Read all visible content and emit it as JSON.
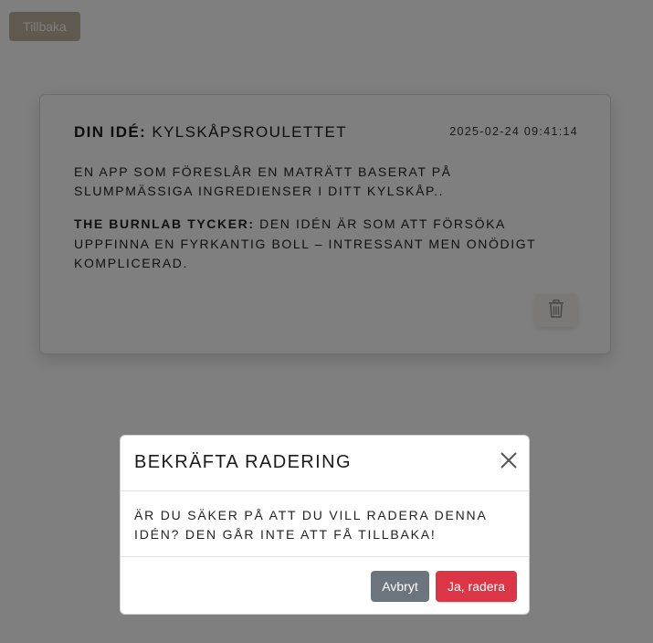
{
  "header": {
    "back_label": "Tillbaka"
  },
  "idea": {
    "title_prefix": "Din idé:",
    "title": "Kylskåpsroulettet",
    "timestamp": "2025-02-24 09:41:14",
    "description": "En app som föreslår en maträtt baserat på slumpmässiga ingredienser i ditt kylskåp..",
    "review_label": "The BurnLab tycker:",
    "review_text": "Den idén är som att försöka uppfinna en fyrkantig boll – intressant men onödigt komplicerad."
  },
  "modal": {
    "title": "Bekräfta radering",
    "body": "Är du säker på att du vill radera denna idén? Den går inte att få tillbaka!",
    "cancel_label": "Avbryt",
    "confirm_label": "Ja, radera"
  },
  "icons": {
    "delete": "trash-icon",
    "close": "close-icon"
  },
  "colors": {
    "cancel_button": "#6c757d",
    "confirm_button": "#dc3545",
    "back_button": "#bfb3a1",
    "overlay": "rgba(0,0,0,0.5)"
  }
}
